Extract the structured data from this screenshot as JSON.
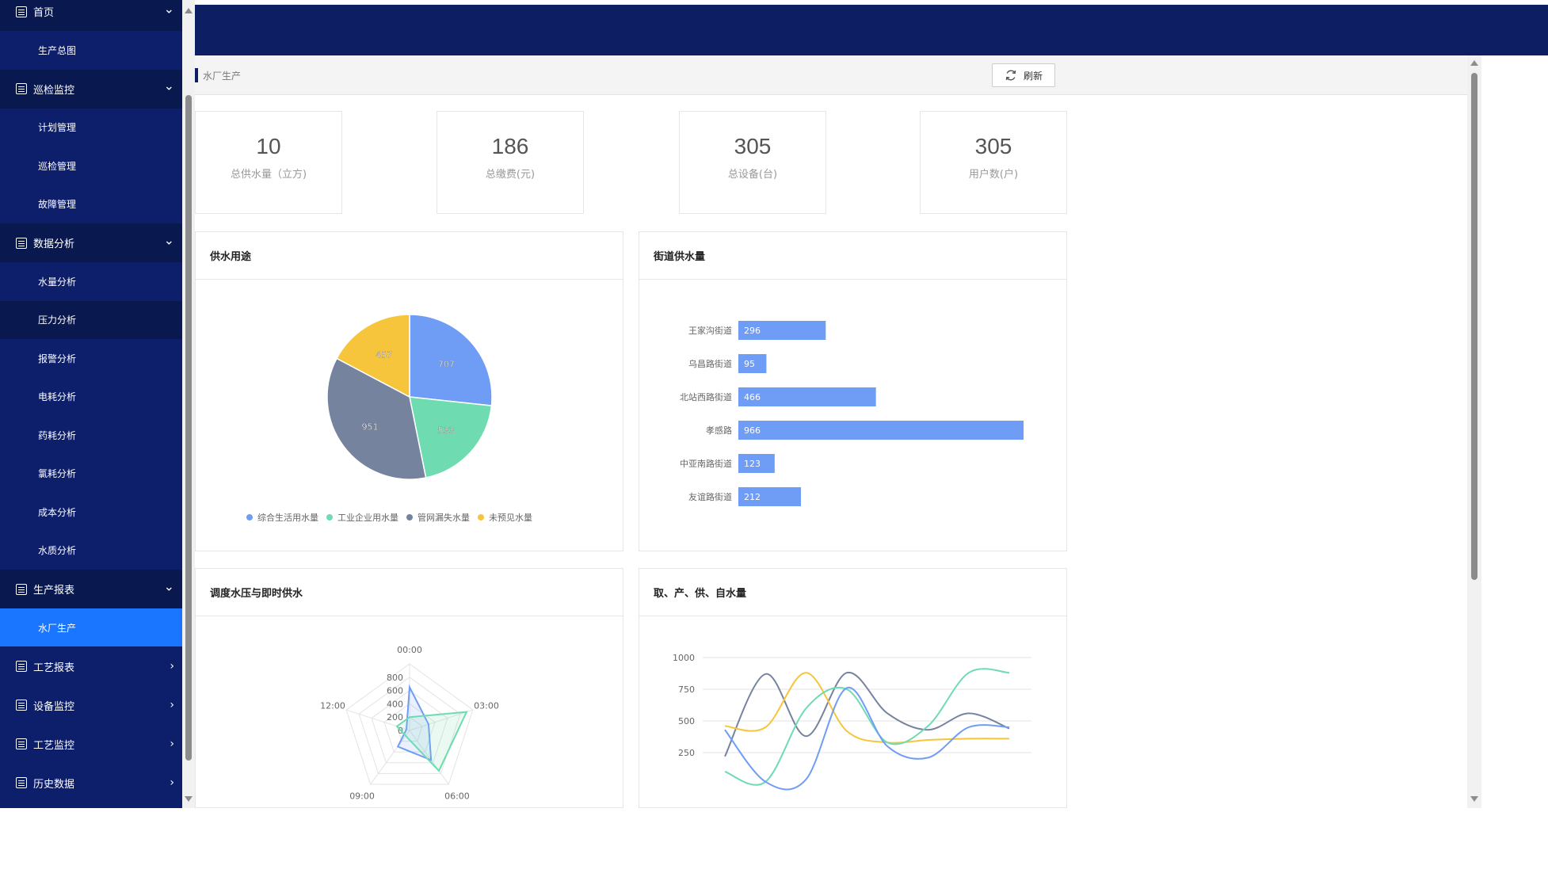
{
  "sidebar": {
    "groups": [
      {
        "label": "首页",
        "expanded": true,
        "items": [
          "生产总图"
        ]
      },
      {
        "label": "巡检监控",
        "expanded": true,
        "items": [
          "计划管理",
          "巡检管理",
          "故障管理"
        ]
      },
      {
        "label": "数据分析",
        "expanded": true,
        "items": [
          "水量分析",
          "压力分析",
          "报警分析",
          "电耗分析",
          "药耗分析",
          "氯耗分析",
          "成本分析",
          "水质分析"
        ]
      },
      {
        "label": "生产报表",
        "expanded": true,
        "items": [
          "水厂生产"
        ]
      },
      {
        "label": "工艺报表",
        "expanded": false,
        "items": []
      },
      {
        "label": "设备监控",
        "expanded": false,
        "items": []
      },
      {
        "label": "工艺监控",
        "expanded": false,
        "items": []
      },
      {
        "label": "历史数据",
        "expanded": false,
        "items": []
      }
    ],
    "active_item": "水厂生产"
  },
  "page": {
    "title": "水厂生产",
    "refresh_label": "刷新"
  },
  "stats": [
    {
      "value": "10",
      "label": "总供水量（立方)"
    },
    {
      "value": "186",
      "label": "总缴费(元)"
    },
    {
      "value": "305",
      "label": "总设备(台)"
    },
    {
      "value": "305",
      "label": "用户数(户)"
    }
  ],
  "panels": {
    "pie_title": "供水用途",
    "bar_title": "街道供水量",
    "radar_title": "调度水压与即时供水",
    "line_title": "取、产、供、自水量"
  },
  "colors": {
    "blue": "#6f9cf5",
    "green": "#6fdbb1",
    "slate": "#75839f",
    "yellow": "#f7c53c",
    "navy": "#0d1e6b",
    "active": "#1b76ff"
  },
  "chart_data": [
    {
      "type": "pie",
      "title": "供水用途",
      "categories": [
        "综合生活用水量",
        "工业企业用水量",
        "管网漏失水量",
        "未预见水量"
      ],
      "values": [
        707,
        533,
        951,
        457
      ],
      "legend": "bottom"
    },
    {
      "type": "bar",
      "orientation": "horizontal",
      "title": "街道供水量",
      "categories": [
        "王家沟街道",
        "乌昌路街道",
        "北站西路街道",
        "孝感路",
        "中亚南路街道",
        "友谊路街道"
      ],
      "values": [
        296,
        95,
        466,
        966,
        123,
        212
      ]
    },
    {
      "type": "radar",
      "title": "调度水压与即时供水",
      "indicators": [
        "00:00",
        "03:00",
        "06:00",
        "09:00",
        "12:00"
      ],
      "axis_ticks": [
        "0",
        "200",
        "400",
        "600",
        "800"
      ],
      "max": 1000,
      "series": [
        {
          "values": [
            650,
            300,
            550,
            300,
            50
          ]
        },
        {
          "values": [
            200,
            900,
            750,
            100,
            200
          ]
        }
      ]
    },
    {
      "type": "line",
      "title": "取、产、供、自水量",
      "y_ticks": [
        "250",
        "500",
        "750",
        "1000"
      ],
      "ylim": [
        0,
        1000
      ],
      "x": [
        0,
        1,
        2,
        3,
        4,
        5,
        6,
        7
      ],
      "series": [
        {
          "values": [
            220,
            870,
            380,
            880,
            560,
            430,
            560,
            440
          ]
        },
        {
          "values": [
            460,
            450,
            880,
            420,
            330,
            350,
            360,
            360
          ]
        },
        {
          "values": [
            100,
            20,
            600,
            750,
            330,
            460,
            880,
            880
          ]
        },
        {
          "values": [
            430,
            20,
            40,
            760,
            300,
            210,
            450,
            450
          ]
        }
      ]
    }
  ]
}
